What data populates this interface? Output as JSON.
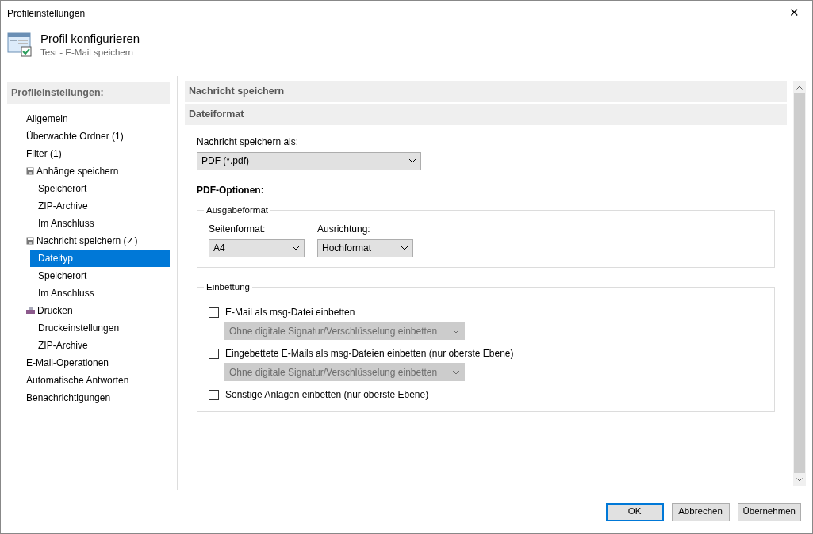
{
  "window": {
    "title": "Profileinstellungen",
    "close": "✕"
  },
  "header": {
    "title": "Profil konfigurieren",
    "subtitle": "Test - E-Mail speichern"
  },
  "sidebar": {
    "title": "Profileinstellungen:",
    "items": [
      {
        "label": "Allgemein",
        "selected": false
      },
      {
        "label": "Überwachte Ordner (1)",
        "selected": false
      },
      {
        "label": "Filter (1)",
        "selected": false
      },
      {
        "label": "Anhänge speichern",
        "kind": "save",
        "selected": false,
        "children": [
          {
            "label": "Speicherort",
            "selected": false
          },
          {
            "label": "ZIP-Archive",
            "selected": false
          },
          {
            "label": "Im Anschluss",
            "selected": false
          }
        ]
      },
      {
        "label": "Nachricht speichern (✓)",
        "kind": "save",
        "selected": false,
        "children": [
          {
            "label": "Dateityp",
            "selected": true
          },
          {
            "label": "Speicherort",
            "selected": false
          },
          {
            "label": "Im Anschluss",
            "selected": false
          }
        ]
      },
      {
        "label": "Drucken",
        "kind": "print",
        "selected": false,
        "children": [
          {
            "label": "Druckeinstellungen",
            "selected": false
          },
          {
            "label": "ZIP-Archive",
            "selected": false
          }
        ]
      },
      {
        "label": "E-Mail-Operationen",
        "selected": false
      },
      {
        "label": "Automatische Antworten",
        "selected": false
      },
      {
        "label": "Benachrichtigungen",
        "selected": false
      }
    ]
  },
  "content": {
    "section_title": "Nachricht speichern",
    "subsection_title": "Dateiformat",
    "format_label": "Nachricht speichern als:",
    "format_value": "PDF (*.pdf)",
    "pdf_options_title": "PDF-Optionen:",
    "output_group": {
      "legend": "Ausgabeformat",
      "fields": [
        {
          "label": "Seitenformat:",
          "value": "A4"
        },
        {
          "label": "Ausrichtung:",
          "value": "Hochformat"
        }
      ]
    },
    "embed_group": {
      "legend": "Einbettung",
      "options": [
        {
          "label": "E-Mail als msg-Datei einbetten",
          "checked": false,
          "dropdown": {
            "value": "Ohne digitale Signatur/Verschlüsselung einbetten",
            "disabled": true
          }
        },
        {
          "label": "Eingebettete E-Mails als msg-Dateien einbetten (nur oberste Ebene)",
          "checked": false,
          "dropdown": {
            "value": "Ohne digitale Signatur/Verschlüsselung einbetten",
            "disabled": true
          }
        },
        {
          "label": "Sonstige Anlagen einbetten (nur oberste Ebene)",
          "checked": false
        }
      ]
    }
  },
  "buttons": [
    {
      "label": "OK",
      "default": true
    },
    {
      "label": "Abbrechen",
      "default": false
    },
    {
      "label": "Übernehmen",
      "default": false
    }
  ]
}
